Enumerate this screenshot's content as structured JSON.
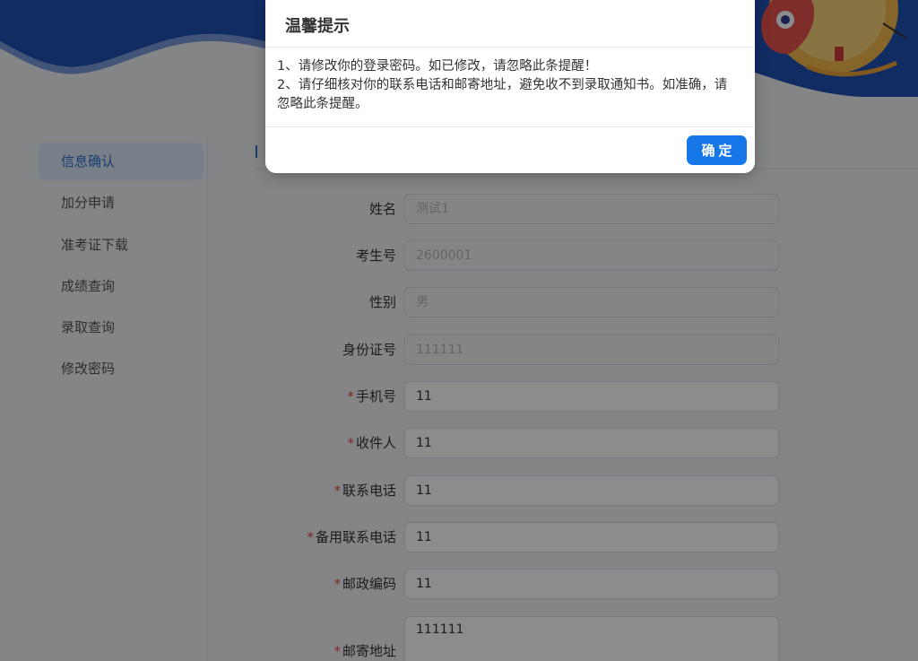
{
  "sidebar": {
    "items": [
      {
        "label": "信息确认"
      },
      {
        "label": "加分申请"
      },
      {
        "label": "准考证下载"
      },
      {
        "label": "成绩查询"
      },
      {
        "label": "录取查询"
      },
      {
        "label": "修改密码"
      }
    ]
  },
  "form": {
    "name": {
      "label": "姓名",
      "value": "测试1"
    },
    "exam_no": {
      "label": "考生号",
      "value": "2600001"
    },
    "gender": {
      "label": "性别",
      "value": "男"
    },
    "id_no": {
      "label": "身份证号",
      "value": "111111"
    },
    "mobile": {
      "label": "手机号",
      "value": "11"
    },
    "recipient": {
      "label": "收件人",
      "value": "11"
    },
    "contact_phone": {
      "label": "联系电话",
      "value": "11"
    },
    "backup_phone": {
      "label": "备用联系电话",
      "value": "11"
    },
    "postcode": {
      "label": "邮政编码",
      "value": "11"
    },
    "address": {
      "label": "邮寄地址",
      "value": "111111"
    },
    "required_mark": "*"
  },
  "dialog": {
    "title": "温馨提示",
    "line1": "1、请修改你的登录密码。如已修改，请忽略此条提醒！",
    "line2": "2、请仔细核对你的联系电话和邮寄地址，避免收不到录取通知书。如准确，请忽略此条提醒。",
    "confirm_label": "确定"
  },
  "colors": {
    "primary": "#1677e8",
    "banner_blue": "#1f4fb4",
    "required": "#e34d4d"
  }
}
